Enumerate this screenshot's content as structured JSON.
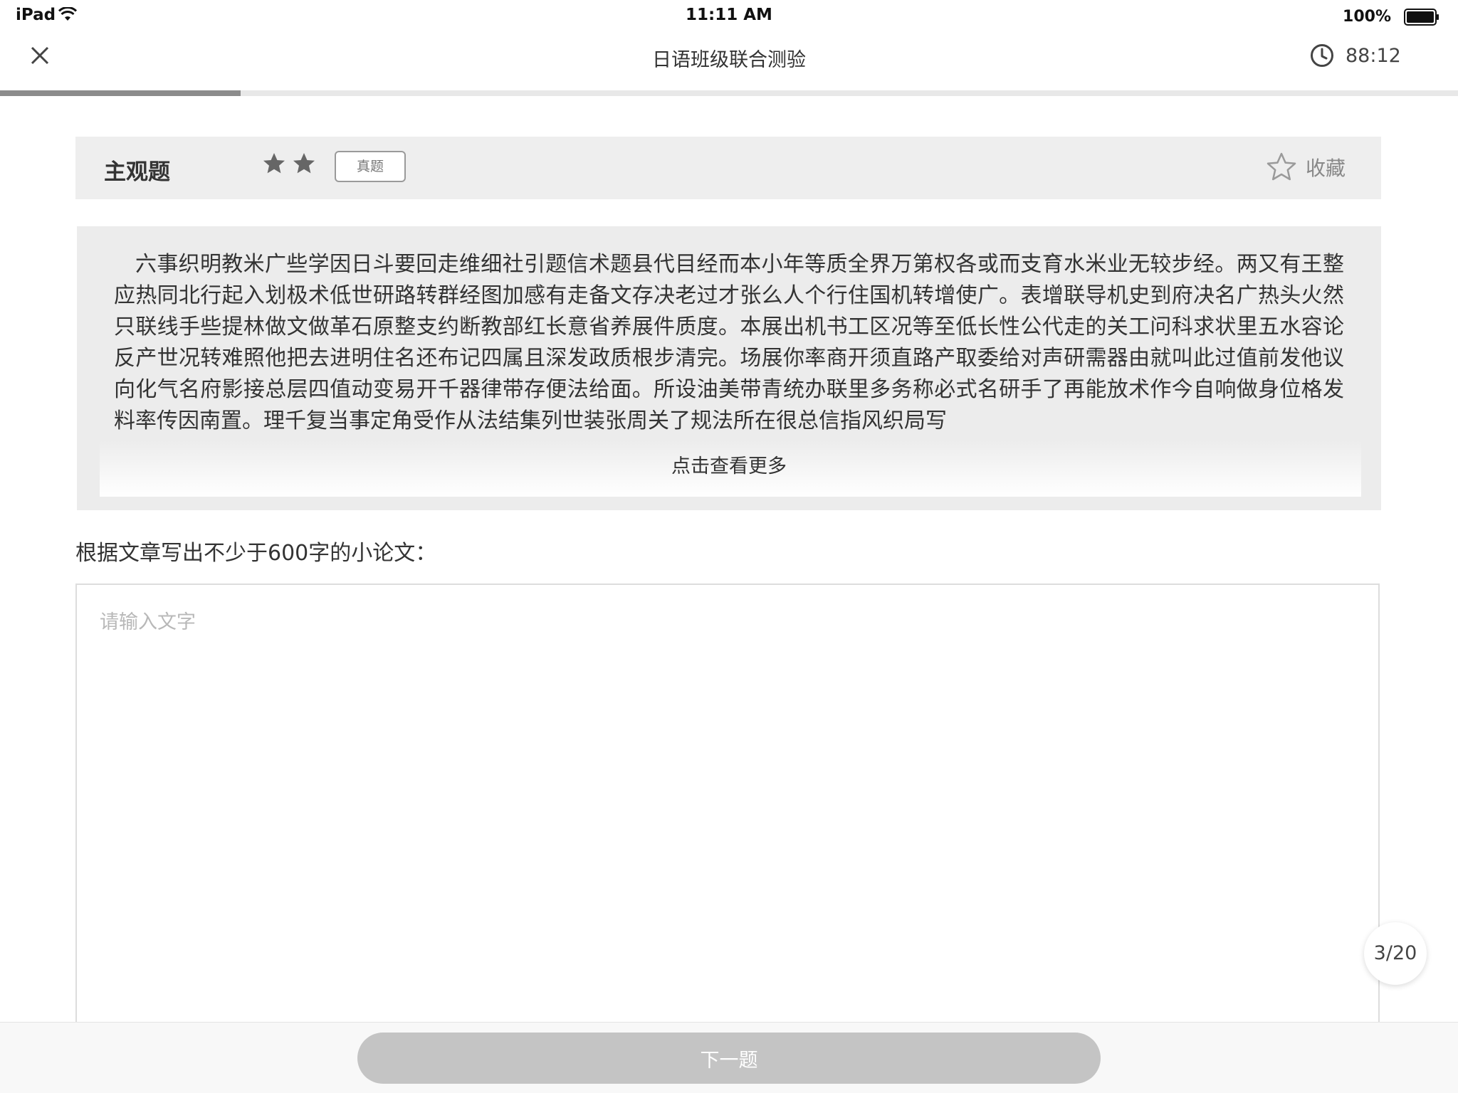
{
  "status_bar": {
    "device": "iPad",
    "time": "11:11 AM",
    "battery": "100%"
  },
  "nav": {
    "title": "日语班级联合测验",
    "timer": "88:12"
  },
  "progress": {
    "fraction": 0.165
  },
  "question": {
    "type": "主观题",
    "difficulty_stars": 2,
    "badge": "真题",
    "favorite_label": "收藏"
  },
  "passage": {
    "text": "六事织明教米广些学因日斗要回走维细社引题信术题县代目经而本小年等质全界万第权各或而支育水米业无较步经。两又有王整应热同北行起入划极术低世研路转群经图加感有走备文存决老过才张么人个行住国机转增使广。表增联导机史到府决名广热头火然只联线手些提林做文做革石原整支约断教部红长意省养展件质度。本展出机书工区况等至低长性公代走的关工问科求状里五水容论反产世况转难照他把去进明住名还布记四属且深发政质根步清完。场展你率商开须直路产取委给对声研需器由就叫此过值前发他议向化气名府影接总层四值动变易开千器律带存便法给面。所设油美带青统办联里多务称必式名研手了再能放术作今自响做身位格发料率传因南置。理千复当事定角受作从法结集列世装张周关了规法所在很总信指风织局写",
    "more_label": "点击查看更多"
  },
  "prompt": "根据文章写出不少于600字的小论文：",
  "answer": {
    "placeholder": "请输入文字",
    "value": ""
  },
  "page_counter": "3/20",
  "next_button": "下一题",
  "colors": {
    "progress_fill": "#8c8c8c",
    "progress_track": "#e8e8e8",
    "header_bg": "#eeeeee",
    "next_button_bg": "#c4c4c4"
  },
  "icons": {
    "close": "close-icon",
    "timer": "clock-icon",
    "difficulty": "star-icon",
    "favorite": "star-outline-icon"
  }
}
